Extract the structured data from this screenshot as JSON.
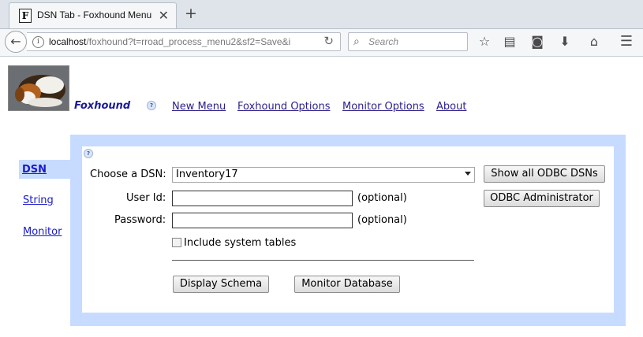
{
  "browser": {
    "tab_title": "DSN Tab - Foxhound Menu",
    "tab_favicon_letter": "F",
    "new_tab_glyph": "+",
    "close_glyph": "✕",
    "url_host": "localhost",
    "url_path": "/foxhound?t=rroad_process_menu2&sf2=Save&i",
    "search_placeholder": "Search",
    "toolbar_icons": [
      "star-icon",
      "reading-list-icon",
      "pocket-icon",
      "download-icon",
      "home-icon",
      "menu-icon"
    ]
  },
  "header": {
    "brand": "Foxhound",
    "help_glyph": "?",
    "links": [
      "New Menu",
      "Foxhound Options",
      "Monitor Options",
      "About"
    ]
  },
  "sidebar": {
    "items": [
      {
        "label": "DSN",
        "active": true
      },
      {
        "label": "String",
        "active": false
      },
      {
        "label": "Monitor",
        "active": false
      }
    ]
  },
  "form": {
    "dsn_label": "Choose a DSN:",
    "dsn_value": "Inventory17",
    "userid_label": "User Id:",
    "userid_value": "",
    "password_label": "Password:",
    "password_value": "",
    "optional_text": "(optional)",
    "include_system_label": "Include system tables",
    "include_system_checked": false,
    "show_all_button": "Show all ODBC DSNs",
    "odbc_admin_button": "ODBC Administrator",
    "display_schema_button": "Display Schema",
    "monitor_db_button": "Monitor Database"
  },
  "colors": {
    "panel_bg": "#c6dbff",
    "brand_color": "#1a1a99",
    "link_color": "#2b1f8a"
  }
}
